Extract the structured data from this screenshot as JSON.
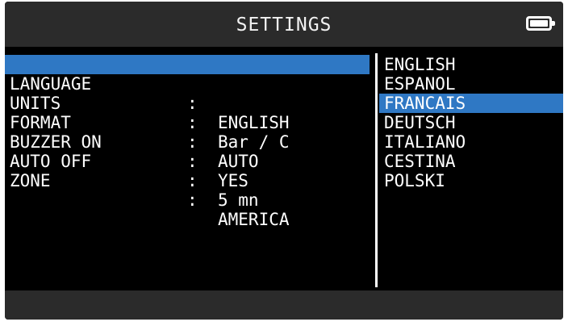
{
  "title": "SETTINGS",
  "battery_icon": "battery-full-icon",
  "accent_color": "#2f78c4",
  "settings": [
    {
      "label": "LANGUAGE",
      "colon": ":",
      "value": "ENGLISH",
      "selected": true
    },
    {
      "label": "UNITS",
      "colon": ":",
      "value": "Bar / C",
      "selected": false
    },
    {
      "label": "FORMAT",
      "colon": ":",
      "value": "AUTO",
      "selected": false
    },
    {
      "label": "BUZZER ON",
      "colon": ":",
      "value": "YES",
      "selected": false
    },
    {
      "label": "AUTO OFF",
      "colon": ":",
      "value": "5 mn",
      "selected": false
    },
    {
      "label": "ZONE",
      "colon": ":",
      "value": "AMERICA",
      "selected": false
    }
  ],
  "language_options": [
    {
      "label": "ENGLISH",
      "selected": false
    },
    {
      "label": "ESPANOL",
      "selected": false
    },
    {
      "label": "FRANCAIS",
      "selected": true
    },
    {
      "label": "DEUTSCH",
      "selected": false
    },
    {
      "label": "ITALIANO",
      "selected": false
    },
    {
      "label": "CESTINA",
      "selected": false
    },
    {
      "label": "POLSKI",
      "selected": false
    }
  ]
}
